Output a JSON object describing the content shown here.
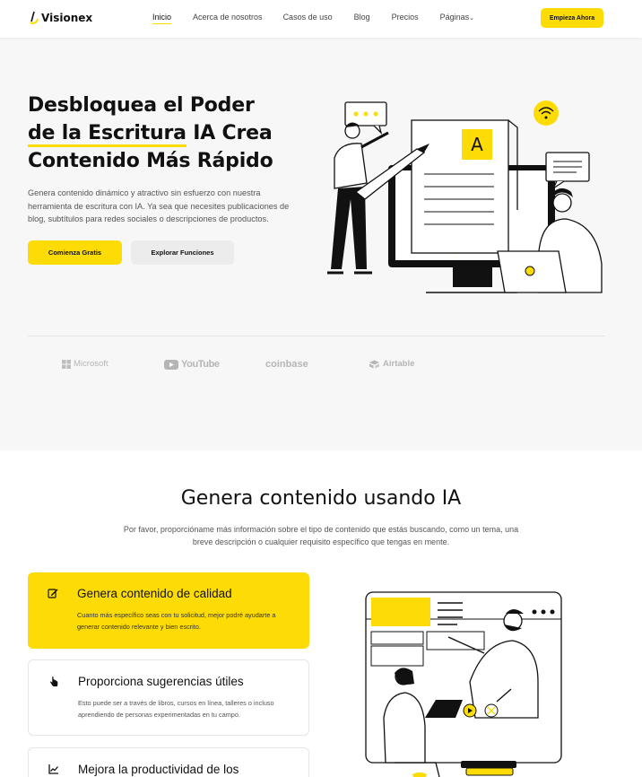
{
  "nav": {
    "brand": "Visionex",
    "links": [
      "Inicio",
      "Acerca de nosotros",
      "Casos de uso",
      "Blog",
      "Precios",
      "Páginas"
    ],
    "cta": "Empieza Ahora"
  },
  "hero": {
    "title_lines": [
      "Desbloquea el Poder",
      "de la Escritura",
      " IA Crea",
      "Contenido Más Rápido"
    ],
    "description": "Genera contenido dinámico y atractivo sin esfuerzo con nuestra herramienta de escritura con IA. Ya sea que necesites publicaciones de blog, subtítulos para redes sociales o descripciones de productos.",
    "primary_button": "Comienza Gratis",
    "secondary_button": "Explorar Funciones",
    "illustration_letter": "A"
  },
  "brands": [
    "Microsoft",
    "YouTube",
    "coinbase",
    "Airtable"
  ],
  "section2": {
    "title": "Genera contenido usando IA",
    "description": "Por favor, proporcióname más información sobre el tipo de contenido que estás buscando, como un tema, una breve descripción o cualquier requisito específico que tengas en mente.",
    "cards": [
      {
        "title": "Genera contenido de calidad",
        "text": "Cuanto más específico seas con tu solicitud, mejor podré ayudarte a generar contenido relevante y bien escrito.",
        "icon": "edit-icon"
      },
      {
        "title": "Proporciona sugerencias útiles",
        "text": "Esto puede ser a través de libros, cursos en línea, talleres o incluso aprendiendo de personas experimentadas en tu campo.",
        "icon": "pointer-hand-icon"
      },
      {
        "title": "Mejora la productividad de los",
        "text": "",
        "icon": "trend-chart-icon"
      }
    ]
  },
  "colors": {
    "accent": "#fddc06",
    "hero_bg": "#f7f7f7",
    "text": "#111111"
  }
}
